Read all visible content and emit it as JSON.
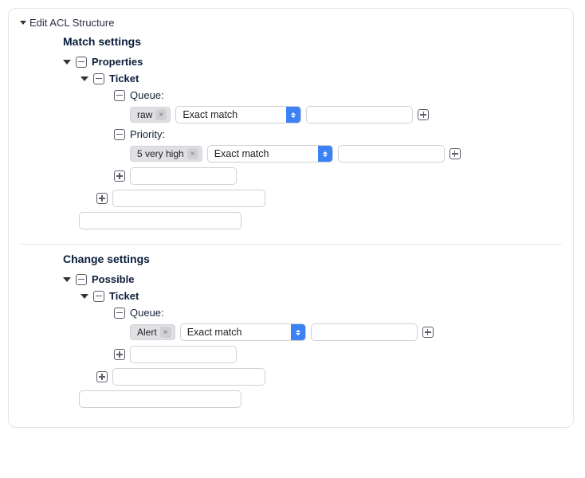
{
  "panel": {
    "title": "Edit ACL Structure"
  },
  "match": {
    "title": "Match settings",
    "properties": {
      "label": "Properties",
      "ticket": {
        "label": "Ticket",
        "queue": {
          "label": "Queue:",
          "tag": "raw",
          "match_mode": "Exact match"
        },
        "priority": {
          "label": "Priority:",
          "tag": "5 very high",
          "match_mode": "Exact match"
        }
      }
    }
  },
  "change": {
    "title": "Change settings",
    "possible": {
      "label": "Possible",
      "ticket": {
        "label": "Ticket",
        "queue": {
          "label": "Queue:",
          "tag": "Alert",
          "match_mode": "Exact match"
        }
      }
    }
  }
}
